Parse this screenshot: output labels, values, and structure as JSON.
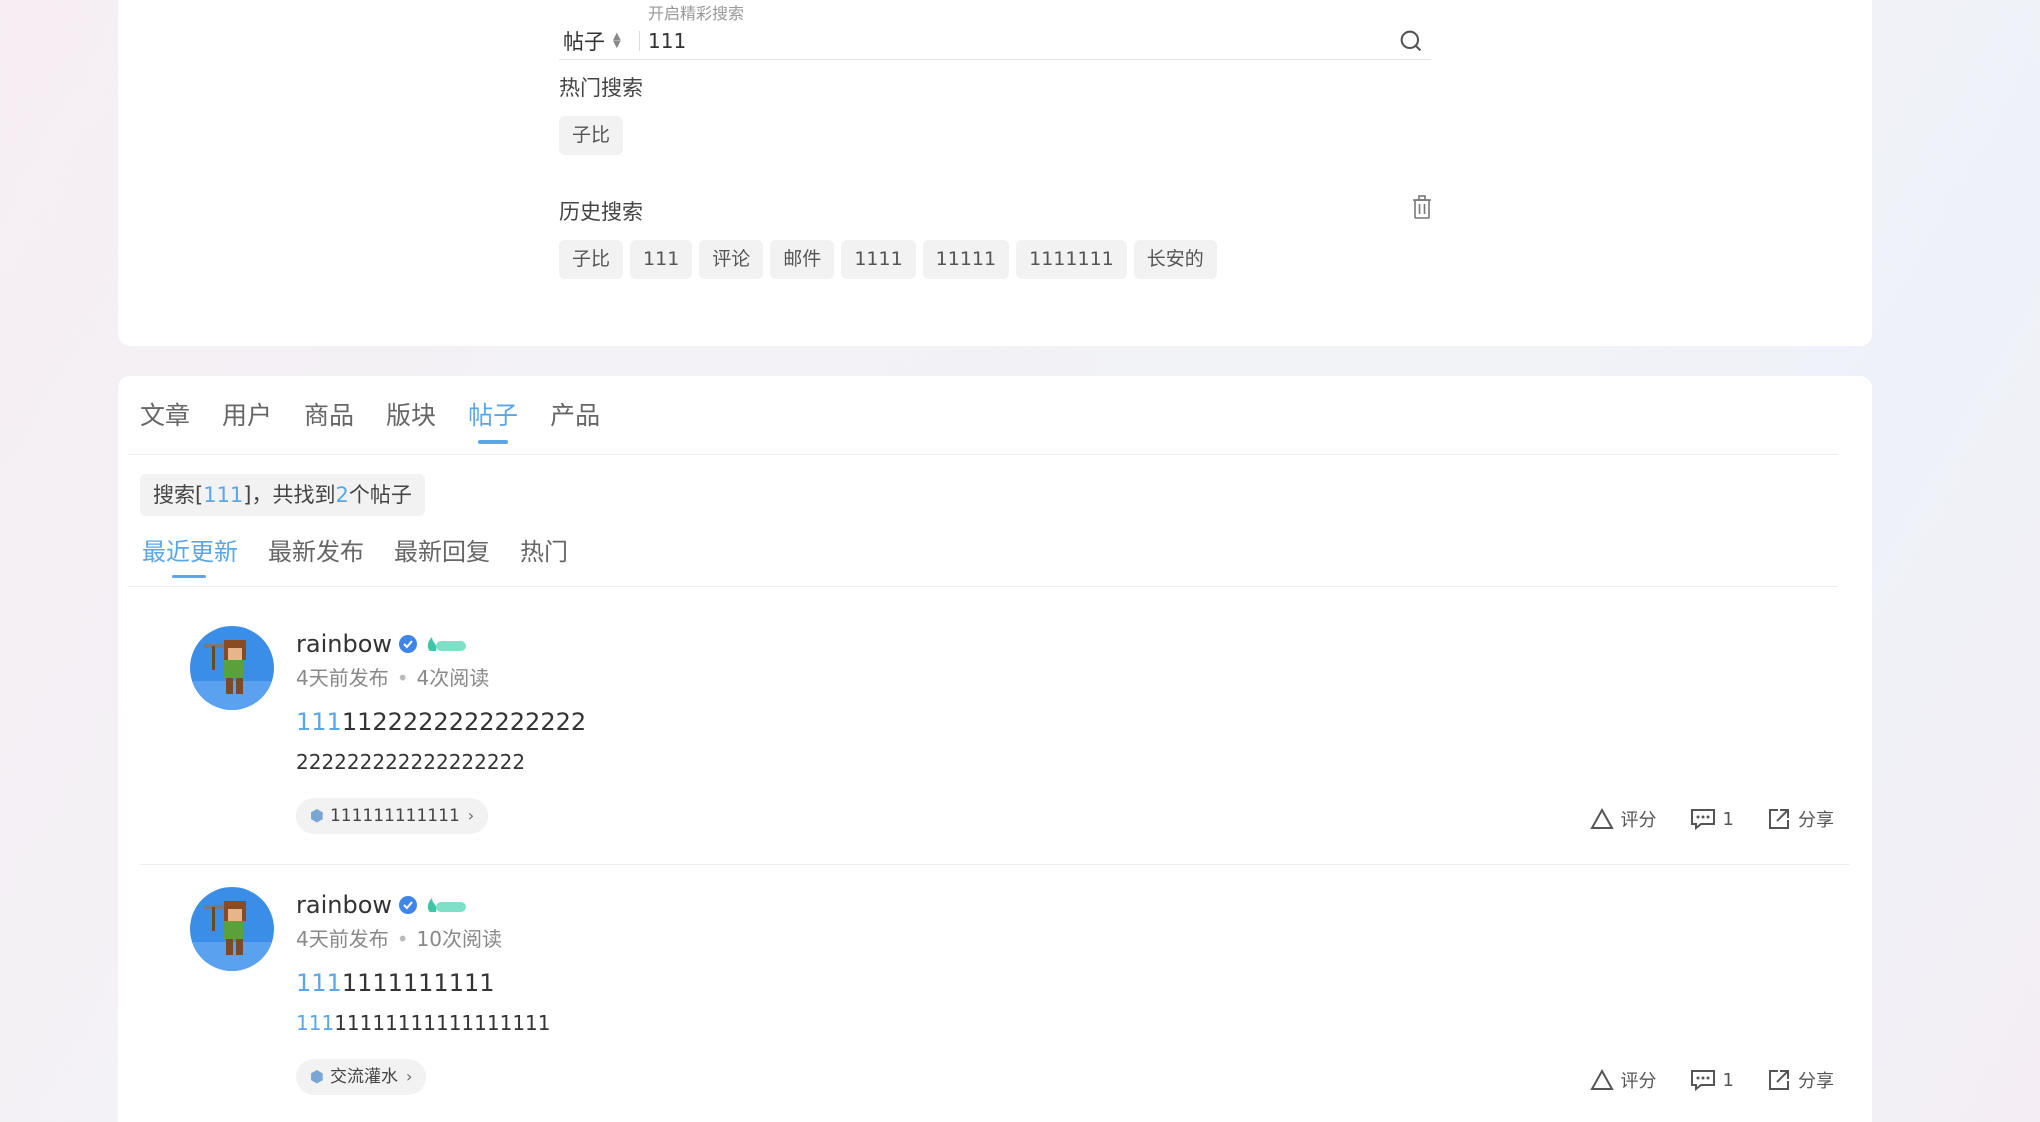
{
  "search": {
    "hint": "开启精彩搜索",
    "type_label": "帖子",
    "query": "111"
  },
  "hot": {
    "title": "热门搜索",
    "items": [
      "子比"
    ]
  },
  "history": {
    "title": "历史搜索",
    "items": [
      "子比",
      "111",
      "评论",
      "邮件",
      "1111",
      "11111",
      "1111111",
      "长安的"
    ]
  },
  "tabs": [
    "文章",
    "用户",
    "商品",
    "版块",
    "帖子",
    "产品"
  ],
  "active_tab": "帖子",
  "summary": {
    "prefix": "搜索[",
    "query": "111",
    "middle": "]，共找到",
    "count": "2",
    "suffix": "个帖子"
  },
  "sort_tabs": [
    "最近更新",
    "最新发布",
    "最新回复",
    "热门"
  ],
  "posts": [
    {
      "author": "rainbow",
      "published": "4天前发布",
      "views": "4次阅读",
      "title_hl": "111",
      "title_rest": "1122222222222222",
      "body_hl": "",
      "body_rest": "222222222222222222",
      "forum": "111111111111",
      "rate_label": "评分",
      "comments": "1",
      "share_label": "分享"
    },
    {
      "author": "rainbow",
      "published": "4天前发布",
      "views": "10次阅读",
      "title_hl": "111",
      "title_rest": "1111111111",
      "body_hl": "111",
      "body_rest": "11111111111111111",
      "forum": "交流灌水",
      "rate_label": "评分",
      "comments": "1",
      "share_label": "分享"
    }
  ],
  "colors": {
    "accent": "#5aa7e8",
    "chip_bg": "#f2f2f2"
  }
}
